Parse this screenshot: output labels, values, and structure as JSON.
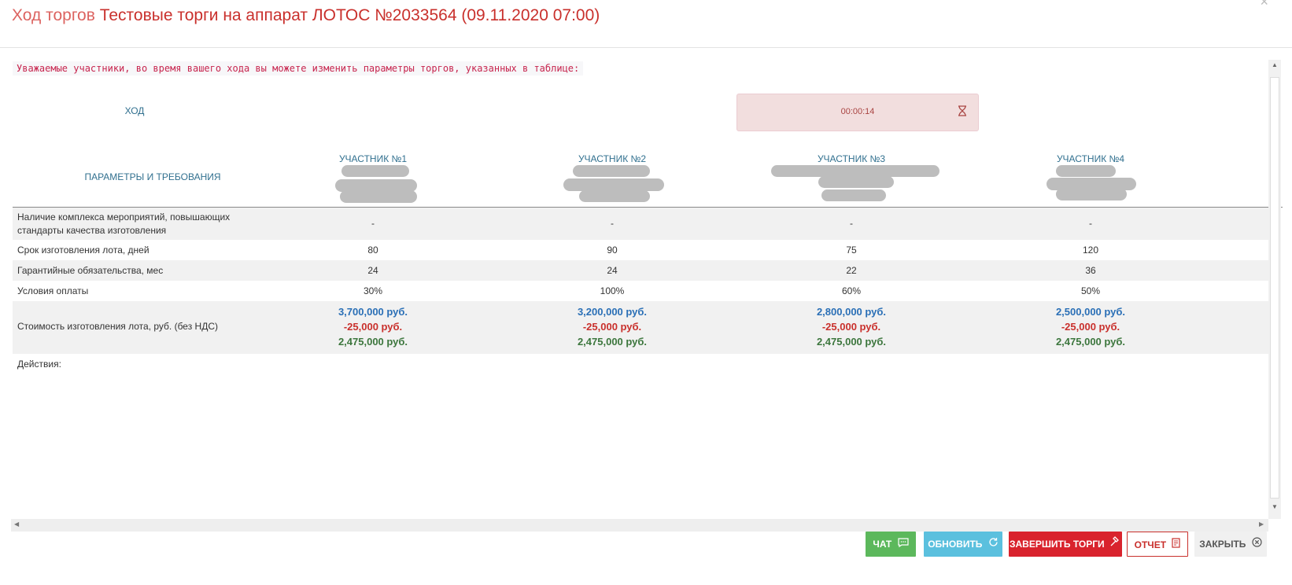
{
  "header": {
    "title_prefix": "Ход торгов",
    "title_main": "Тестовые торги на аппарат ЛОТОС №2033564 (09.11.2020 07:00)",
    "close_symbol": "×"
  },
  "notice": "Уважаемые участники, во время вашего хода вы можете изменить параметры торгов, указанных в таблице:",
  "turn": {
    "label": "ХОД",
    "timer": "00:00:14",
    "timer_icon": "hourglass-icon"
  },
  "table": {
    "params_label": "ПАРАМЕТРЫ И ТРЕБОВАНИЯ",
    "participants": [
      "УЧАСТНИК №1",
      "УЧАСТНИК №2",
      "УЧАСТНИК №3",
      "УЧАСТНИК №4"
    ],
    "rows": [
      {
        "label": "Наличие комплекса мероприятий, повышающих стандарты качества изготовления",
        "values": [
          "-",
          "-",
          "-",
          "-"
        ]
      },
      {
        "label": "Срок изготовления лота, дней",
        "values": [
          "80",
          "90",
          "75",
          "120"
        ]
      },
      {
        "label": "Гарантийные обязательства, мес",
        "values": [
          "24",
          "24",
          "22",
          "36"
        ]
      },
      {
        "label": "Условия оплаты",
        "values": [
          "30%",
          "100%",
          "60%",
          "50%"
        ]
      }
    ],
    "price_row": {
      "label": "Стоимость изготовления лота, руб. (без НДС)",
      "values": [
        {
          "base": "3,700,000 руб.",
          "discount": "-25,000 руб.",
          "total": "2,475,000 руб."
        },
        {
          "base": "3,200,000 руб.",
          "discount": "-25,000 руб.",
          "total": "2,475,000 руб."
        },
        {
          "base": "2,800,000 руб.",
          "discount": "-25,000 руб.",
          "total": "2,475,000 руб."
        },
        {
          "base": "2,500,000 руб.",
          "discount": "-25,000 руб.",
          "total": "2,475,000 руб."
        }
      ]
    },
    "actions_label": "Действия:"
  },
  "footer": {
    "chat": "ЧАТ",
    "refresh": "ОБНОВИТЬ",
    "finish": "ЗАВЕРШИТЬ ТОРГИ",
    "report": "ОТЧЕТ",
    "close": "ЗАКРЫТЬ"
  },
  "colors": {
    "accent_red": "#c9302c",
    "price_blue": "#2a6fb6",
    "price_green": "#3c763d",
    "chat_green": "#5cb85c",
    "refresh_blue": "#5bc0de",
    "finish_red": "#d9232d"
  }
}
